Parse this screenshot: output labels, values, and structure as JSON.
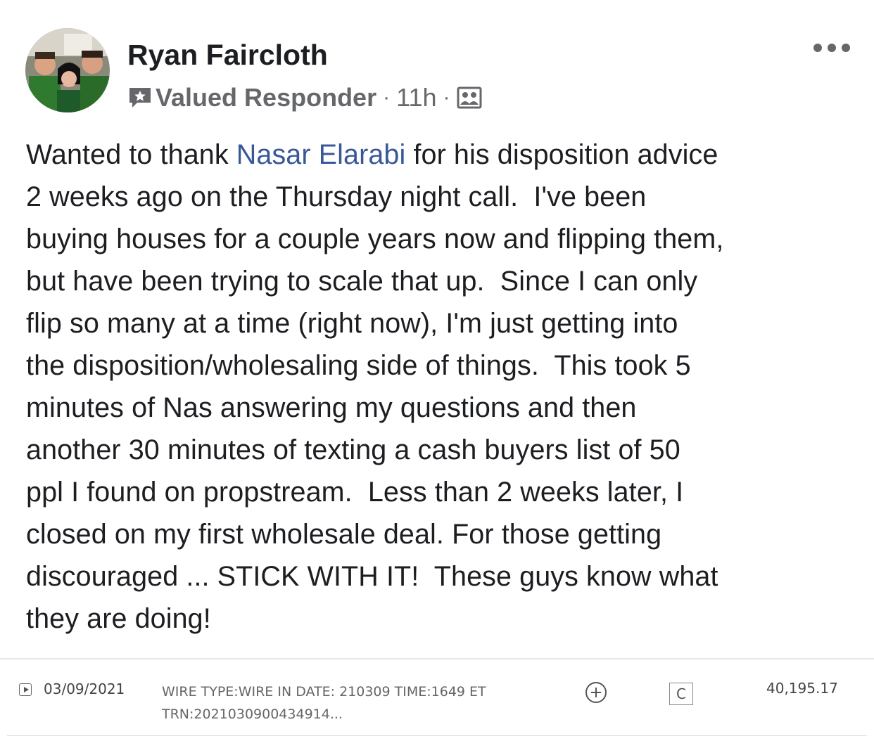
{
  "post": {
    "author": "Ryan Faircloth",
    "badge_label": "Valued Responder",
    "dot1": "·",
    "time": "11h",
    "dot2": "·",
    "body": {
      "line1_before": "Wanted to thank ",
      "mention": "Nasar Elarabi",
      "line1_after": " for his disposition advice",
      "lines": [
        "2 weeks ago on the Thursday night call.  I've been",
        "buying houses for a couple years now and flipping them,",
        "but have been trying to scale that up.  Since I can only",
        "flip so many at a time (right now), I'm just getting into",
        "the disposition/wholesaling side of things.  This took 5",
        "minutes of Nas answering my questions and then",
        "another 30 minutes of texting a cash buyers list of 50",
        "ppl I found on propstream.  Less than 2 weeks later, I",
        "closed on my first wholesale deal. For those getting",
        "discouraged ... STICK WITH IT!  These guys know what",
        "they are doing!"
      ]
    },
    "colors": {
      "mention": "#385898",
      "text": "#1c1e21",
      "meta": "#65676b"
    },
    "icons": {
      "badge": "valued-responder-badge-icon",
      "privacy": "group-members-icon",
      "more": "more-options-icon"
    }
  },
  "bank": {
    "date": "03/09/2021",
    "desc_line1": "WIRE TYPE:WIRE IN DATE: 210309 TIME:1649 ET",
    "desc_line2": "TRN:2021030900434914...",
    "c_label": "C",
    "amount": "40,195.17"
  }
}
